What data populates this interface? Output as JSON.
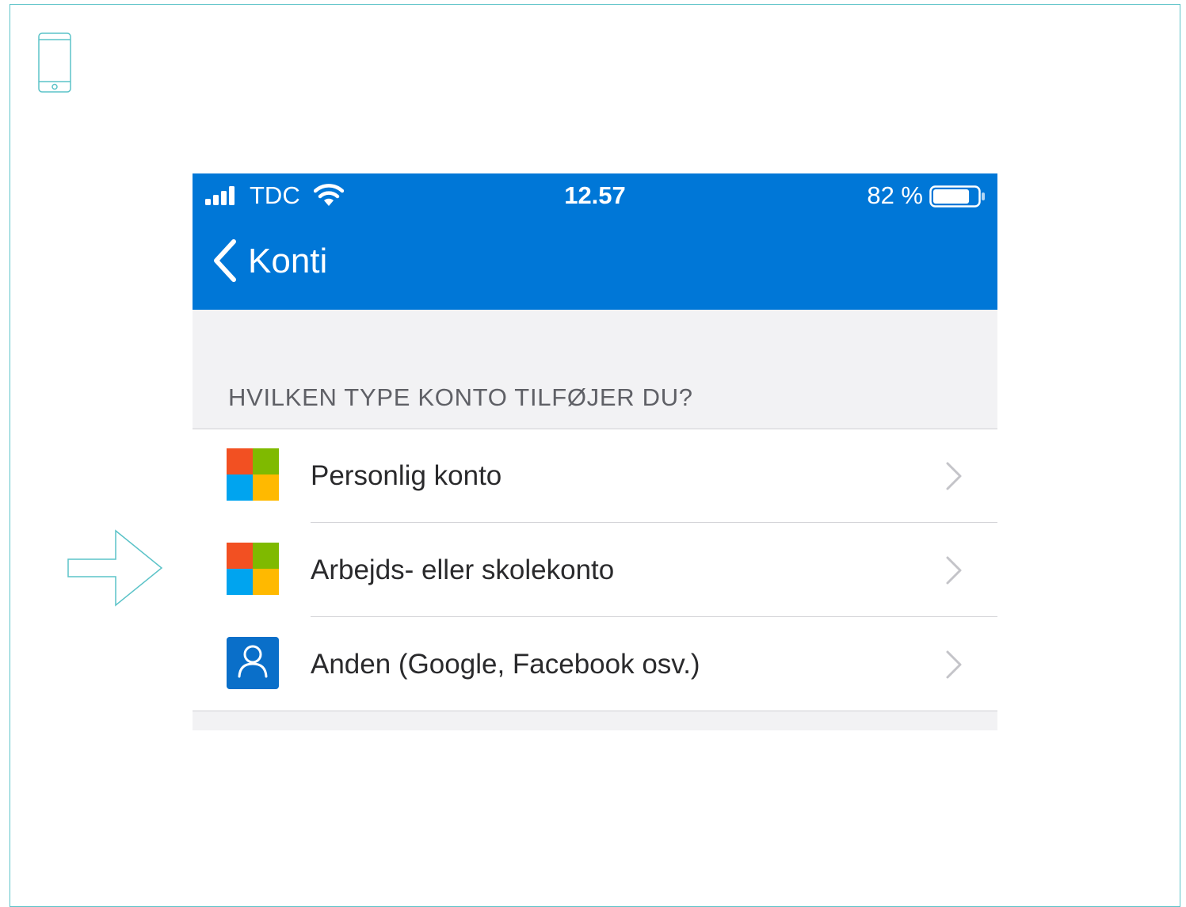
{
  "status_bar": {
    "carrier": "TDC",
    "time": "12.57",
    "battery_percent": "82 %",
    "battery_level": 0.82,
    "signal_icon": "cell-signal-icon",
    "wifi_icon": "wifi-icon"
  },
  "nav": {
    "back_label": "Konti",
    "back_icon": "chevron-left-icon"
  },
  "section": {
    "header": "HVILKEN TYPE KONTO TILFØJER DU?"
  },
  "options": [
    {
      "label": "Personlig konto",
      "icon": "microsoft-logo-icon"
    },
    {
      "label": "Arbejds- eller skolekonto",
      "icon": "microsoft-logo-icon"
    },
    {
      "label": "Anden (Google, Facebook osv.)",
      "icon": "user-icon"
    }
  ],
  "decorations": {
    "phone_icon": "smartphone-icon",
    "pointer_icon": "arrow-right-icon"
  },
  "colors": {
    "accent_blue": "#0077d7",
    "frame_teal": "#5cc3c8",
    "ms_red": "#f25022",
    "ms_green": "#7fba00",
    "ms_blue": "#00a4ef",
    "ms_yellow": "#ffb900"
  }
}
